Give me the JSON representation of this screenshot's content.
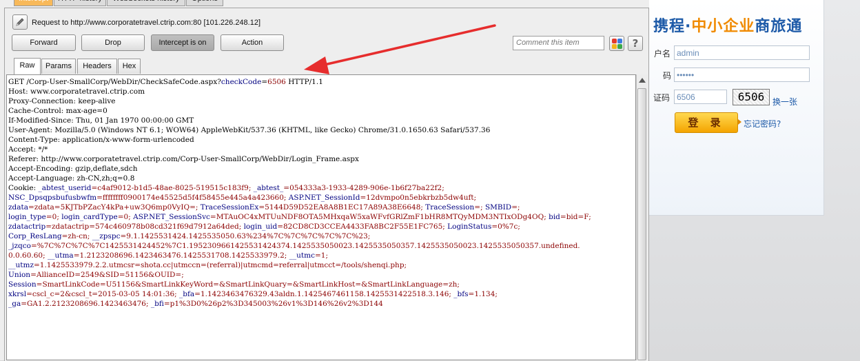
{
  "burp": {
    "top_tabs": [
      {
        "label": "Intercept"
      },
      {
        "label": "HTTP history"
      },
      {
        "label": "WebSockets history"
      },
      {
        "label": "Options"
      }
    ],
    "request_info": "Request to http://www.corporatetravel.ctrip.com:80  [101.226.248.12]",
    "buttons": {
      "forward": "Forward",
      "drop": "Drop",
      "intercept": "Intercept is on",
      "action": "Action"
    },
    "comment_placeholder": "Comment this item",
    "view_tabs": [
      {
        "label": "Raw"
      },
      {
        "label": "Params"
      },
      {
        "label": "Headers"
      },
      {
        "label": "Hex"
      }
    ],
    "colors": {
      "tab_active": "#f8b95a",
      "header_name": "#000000",
      "param_name": "#000080",
      "param_value": "#8b0000"
    },
    "request_lines": [
      [
        {
          "t": "GET /Corp-User-SmallCorp/WebDir/CheckSafeCode.aspx?",
          "c": "k"
        },
        {
          "t": "checkCode",
          "c": "n"
        },
        {
          "t": "=",
          "c": "k"
        },
        {
          "t": "6506",
          "c": "v"
        },
        {
          "t": " HTTP/1.1",
          "c": "k"
        }
      ],
      [
        {
          "t": "Host: www.corporatetravel.ctrip.com",
          "c": "k"
        }
      ],
      [
        {
          "t": "Proxy-Connection: keep-alive",
          "c": "k"
        }
      ],
      [
        {
          "t": "Cache-Control: max-age=0",
          "c": "k"
        }
      ],
      [
        {
          "t": "If-Modified-Since: Thu, 01 Jan 1970 00:00:00 GMT",
          "c": "k"
        }
      ],
      [
        {
          "t": "User-Agent: Mozilla/5.0 (Windows NT 6.1; WOW64) AppleWebKit/537.36 (KHTML, like Gecko) Chrome/31.0.1650.63 Safari/537.36",
          "c": "k"
        }
      ],
      [
        {
          "t": "Content-Type: application/x-www-form-urlencoded",
          "c": "k"
        }
      ],
      [
        {
          "t": "Accept: */*",
          "c": "k"
        }
      ],
      [
        {
          "t": "Referer: http://www.corporatetravel.ctrip.com/Corp-User-SmallCorp/WebDir/Login_Frame.aspx",
          "c": "k"
        }
      ],
      [
        {
          "t": "Accept-Encoding: gzip,deflate,sdch",
          "c": "k"
        }
      ],
      [
        {
          "t": "Accept-Language: zh-CN,zh;q=0.8",
          "c": "k"
        }
      ],
      [
        {
          "t": "Cookie: ",
          "c": "k"
        },
        {
          "t": "_abtest_userid",
          "c": "n"
        },
        {
          "t": "=c4af9012-b1d5-48ae-8025-519515c183f9; ",
          "c": "v"
        },
        {
          "t": "_abtest_",
          "c": "n"
        },
        {
          "t": "=054333a3-1933-4289-906e-1b6f27ba22f2;",
          "c": "v"
        }
      ],
      [
        {
          "t": "NSC_Dpsqpsbufusbwfm",
          "c": "n"
        },
        {
          "t": "=ffffffff0900174e45525d5f4f58455e445a4a423660; ",
          "c": "v"
        },
        {
          "t": "ASP.NET_SessionId",
          "c": "n"
        },
        {
          "t": "=12dvmpo0n5ebkrbzb5dw4uft;",
          "c": "v"
        }
      ],
      [
        {
          "t": "zdata",
          "c": "n"
        },
        {
          "t": "=zdata=5KJTbPZacY4kPa+uw3Q6mp0VyIQ=; ",
          "c": "v"
        },
        {
          "t": "TraceSessionEx",
          "c": "n"
        },
        {
          "t": "=5144D59D52EA8A8B1EC17A89A38E6648; ",
          "c": "v"
        },
        {
          "t": "TraceSession",
          "c": "n"
        },
        {
          "t": "=; ",
          "c": "v"
        },
        {
          "t": "SMBID",
          "c": "n"
        },
        {
          "t": "=;",
          "c": "v"
        }
      ],
      [
        {
          "t": "login_type",
          "c": "n"
        },
        {
          "t": "=0; ",
          "c": "v"
        },
        {
          "t": "login_cardType",
          "c": "n"
        },
        {
          "t": "=0; ",
          "c": "v"
        },
        {
          "t": "ASP.NET_SessionSvc",
          "c": "n"
        },
        {
          "t": "=MTAuOC4xMTUuNDF8OTA5MHxqaW5xaWFvfGRlZmF1bHR8MTQyMDM3NTIxODg4OQ; ",
          "c": "v"
        },
        {
          "t": "bid",
          "c": "n"
        },
        {
          "t": "=bid=F;",
          "c": "v"
        }
      ],
      [
        {
          "t": "zdatactrip",
          "c": "n"
        },
        {
          "t": "=zdatactrip=574c460978b08cd321f69d7912a64ded; ",
          "c": "v"
        },
        {
          "t": "login_uid",
          "c": "n"
        },
        {
          "t": "=82CD8CD3CCEA4433FA8BC2F55E1FC765; ",
          "c": "v"
        },
        {
          "t": "LoginStatus",
          "c": "n"
        },
        {
          "t": "=0%7c;",
          "c": "v"
        }
      ],
      [
        {
          "t": "Corp_ResLang",
          "c": "n"
        },
        {
          "t": "=zh-cn; ",
          "c": "v"
        },
        {
          "t": "__zpspc",
          "c": "n"
        },
        {
          "t": "=9.1.1425531424.1425535050.63%234%7C%7C%7C%7C%7C%23;",
          "c": "v"
        }
      ],
      [
        {
          "t": "_jzqco",
          "c": "n"
        },
        {
          "t": "=%7C%7C%7C%7C1425531424452%7C1.1952309661425531424374.1425535050023.1425535050357.1425535050023.1425535050357.undefined.",
          "c": "v"
        }
      ],
      [
        {
          "t": "0.0.60.60; ",
          "c": "v"
        },
        {
          "t": "__utma",
          "c": "n"
        },
        {
          "t": "=1.2123208696.1423463476.1425531708.1425533979.2; ",
          "c": "v"
        },
        {
          "t": "__utmc",
          "c": "n"
        },
        {
          "t": "=1;",
          "c": "v"
        }
      ],
      [
        {
          "t": "__utmz",
          "c": "n"
        },
        {
          "t": "=1.1425533979.2.2.utmcsr=shota.cc|utmccn=(referral)|utmcmd=referral|utmcct=/tools/shenqi.php;",
          "c": "v"
        }
      ],
      [
        {
          "t": "Union",
          "c": "n"
        },
        {
          "t": "=AllianceID=2549&SID=51156&OUID=;",
          "c": "v"
        }
      ],
      [
        {
          "t": "Session",
          "c": "n"
        },
        {
          "t": "=SmartLinkCode=U51156&SmartLinkKeyWord=&SmartLinkQuary=&SmartLinkHost=&SmartLinkLanguage=zh;",
          "c": "v"
        }
      ],
      [
        {
          "t": "xkrsl",
          "c": "n"
        },
        {
          "t": "=cscl_c=2&cscl_t=2015-03-05 14:01:36; ",
          "c": "v"
        },
        {
          "t": "_bfa",
          "c": "n"
        },
        {
          "t": "=1.1423463476329.43aldn.1.1425467461158.1425531422518.3.146; ",
          "c": "v"
        },
        {
          "t": "_bfs",
          "c": "n"
        },
        {
          "t": "=1.134;",
          "c": "v"
        }
      ],
      [
        {
          "t": "_ga",
          "c": "n"
        },
        {
          "t": "=GA1.2.2123208696.1423463476; ",
          "c": "v"
        },
        {
          "t": "_bfi",
          "c": "n"
        },
        {
          "t": "=p1%3D0%26p2%3D345003%26v1%3D146%26v2%3D144",
          "c": "v"
        }
      ]
    ]
  },
  "site": {
    "logo_part1": "携程",
    "logo_dot": "·",
    "logo_part2": "中小企业",
    "logo_part3": "商旅通",
    "username_label": "户名",
    "username_value": "admin",
    "password_label": "码",
    "password_value": "••••••",
    "captcha_label": "证码",
    "captcha_value": "6506",
    "captcha_image_text": "6506",
    "refresh_link": "换一张",
    "login_button": "登 录",
    "forgot_link": "忘记密码?",
    "colors": {
      "brand_blue": "#1d5aa8",
      "brand_orange": "#f08a00"
    }
  }
}
